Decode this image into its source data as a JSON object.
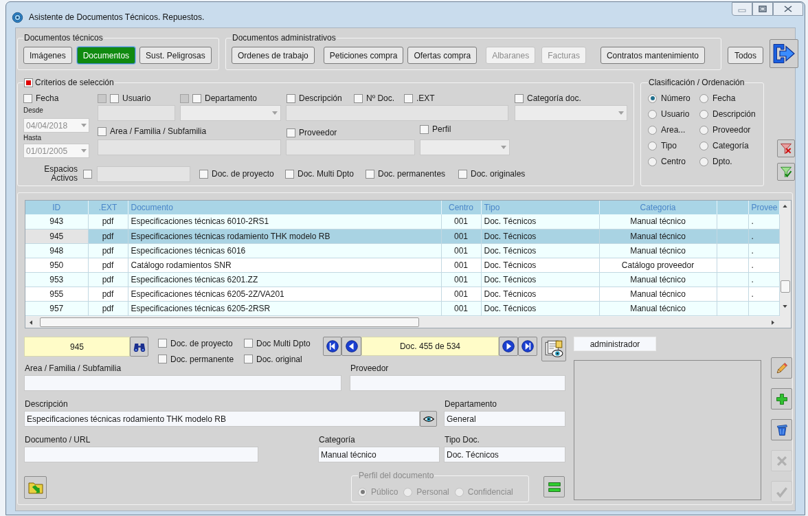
{
  "window": {
    "title": "Asistente de Documentos Técnicos. Repuestos."
  },
  "document_groups": [
    {
      "title": "Documentos técnicos",
      "buttons": [
        {
          "label": "Imágenes",
          "selected": false,
          "disabled": false
        },
        {
          "label": "Documentos",
          "selected": true,
          "disabled": false
        },
        {
          "label": "Sust. Peligrosas",
          "selected": false,
          "disabled": false
        }
      ]
    },
    {
      "title": "Documentos administrativos",
      "buttons": [
        {
          "label": "Ordenes de trabajo",
          "selected": false,
          "disabled": false
        },
        {
          "label": "Peticiones compra",
          "selected": false,
          "disabled": false
        },
        {
          "label": "Ofertas compra",
          "selected": false,
          "disabled": false
        },
        {
          "label": "Albaranes",
          "selected": false,
          "disabled": true
        },
        {
          "label": "Facturas",
          "selected": false,
          "disabled": true
        },
        {
          "label": "Contratos mantenimiento",
          "selected": false,
          "disabled": false
        }
      ]
    }
  ],
  "all_button": {
    "label": "Todos"
  },
  "criteria": {
    "title": "Criterios de selección",
    "checked": true,
    "date": {
      "label": "Fecha",
      "checked": false,
      "from_label": "Desde",
      "from": "04/04/2018",
      "to_label": "Hasta",
      "to": "01/01/2005"
    },
    "user": {
      "label": "Usuario",
      "checked": false,
      "secondary": {
        "disabled": true
      }
    },
    "department": {
      "label": "Departamento",
      "checked": false,
      "secondary": {
        "disabled": true
      }
    },
    "description": {
      "label": "Descripción",
      "checked": false
    },
    "doc_number": {
      "label": "Nº Doc.",
      "checked": false
    },
    "extension": {
      "label": ".EXT",
      "checked": false
    },
    "category": {
      "label": "Categoría doc.",
      "checked": false
    },
    "area": {
      "label": "Area / Familia / Subfamilia",
      "checked": false
    },
    "supplier": {
      "label": "Proveedor",
      "checked": false
    },
    "profile": {
      "label": "Perfil",
      "checked": false
    },
    "spaces": {
      "label": "Espacios Activos",
      "checked": false
    },
    "flags": [
      {
        "label": "Doc. de proyecto",
        "checked": false
      },
      {
        "label": "Doc. Multi Dpto",
        "checked": false
      },
      {
        "label": "Doc. permanentes",
        "checked": false
      },
      {
        "label": "Doc. originales",
        "checked": false
      }
    ]
  },
  "sorting": {
    "title": "Clasificación / Ordenación",
    "options": [
      {
        "label": "Número",
        "selected": true
      },
      {
        "label": "Fecha",
        "selected": false
      },
      {
        "label": "Usuario",
        "selected": false
      },
      {
        "label": "Descripción",
        "selected": false
      },
      {
        "label": "Area...",
        "selected": false
      },
      {
        "label": "Proveedor",
        "selected": false
      },
      {
        "label": "Tipo",
        "selected": false
      },
      {
        "label": "Categoría",
        "selected": false
      },
      {
        "label": "Centro",
        "selected": false
      },
      {
        "label": "Dpto.",
        "selected": false
      }
    ]
  },
  "table": {
    "columns": [
      "ID",
      ".EXT",
      "Documento",
      "Centro",
      "Tipo",
      "Categoria",
      "Provee"
    ],
    "rows": [
      {
        "cells": [
          "943",
          "pdf",
          "Especificaciones técnicas 6010-2RS1",
          "001",
          "Doc. Técnicos",
          "Manual técnico",
          "."
        ],
        "selected": false
      },
      {
        "cells": [
          "945",
          "pdf",
          "Especificaciones técnicas rodamiento THK modelo RB",
          "001",
          "Doc. Técnicos",
          "Manual técnico",
          "."
        ],
        "selected": true
      },
      {
        "cells": [
          "948",
          "pdf",
          "Especificaciones técnicas 6016",
          "001",
          "Doc. Técnicos",
          "Manual técnico",
          "."
        ],
        "selected": false
      },
      {
        "cells": [
          "950",
          "pdf",
          "Catálogo rodamientos SNR",
          "001",
          "Doc. Técnicos",
          "Catálogo proveedor",
          "."
        ],
        "selected": false
      },
      {
        "cells": [
          "953",
          "pdf",
          "Especificaciones técnicas 6201.ZZ",
          "001",
          "Doc. Técnicos",
          "Manual técnico",
          "."
        ],
        "selected": false
      },
      {
        "cells": [
          "955",
          "pdf",
          "Especificaciones técnicas 6205-2Z/VA201",
          "001",
          "Doc. Técnicos",
          "Manual técnico",
          "."
        ],
        "selected": false
      },
      {
        "cells": [
          "957",
          "pdf",
          "Especificaciones técnicas 6205-2RSR",
          "001",
          "Doc. Técnicos",
          "Manual técnico"
        ],
        "selected": false
      }
    ]
  },
  "record": {
    "id": "945",
    "flags": [
      {
        "label": "Doc. de proyecto",
        "checked": false
      },
      {
        "label": "Doc Multi Dpto",
        "checked": false
      },
      {
        "label": "Doc. permanente",
        "checked": false
      },
      {
        "label": "Doc. original",
        "checked": false
      }
    ],
    "position": "Doc. 455 de 534",
    "user": "administrador",
    "area": {
      "label": "Area / Familia / Subfamilia"
    },
    "supplier": {
      "label": "Proveedor"
    },
    "description": {
      "label": "Descripción",
      "value": "Especificaciones técnicas rodamiento THK modelo RB"
    },
    "department": {
      "label": "Departamento",
      "value": "General"
    },
    "document_url": {
      "label": "Documento / URL"
    },
    "category": {
      "label": "Categoría",
      "value": "Manual técnico"
    },
    "doc_type": {
      "label": "Tipo Doc.",
      "value": "Doc. Técnicos"
    },
    "profile": {
      "title": "Perfil del documento",
      "disabled": true,
      "options": [
        {
          "label": "Público",
          "selected": true
        },
        {
          "label": "Personal",
          "selected": false
        },
        {
          "label": "Confidencial",
          "selected": false
        }
      ]
    },
    "side_buttons": [
      {
        "kind": "edit",
        "disabled": false
      },
      {
        "kind": "add",
        "disabled": false
      },
      {
        "kind": "delete",
        "disabled": false
      },
      {
        "kind": "cancel",
        "disabled": true
      },
      {
        "kind": "accept",
        "disabled": true
      }
    ]
  }
}
